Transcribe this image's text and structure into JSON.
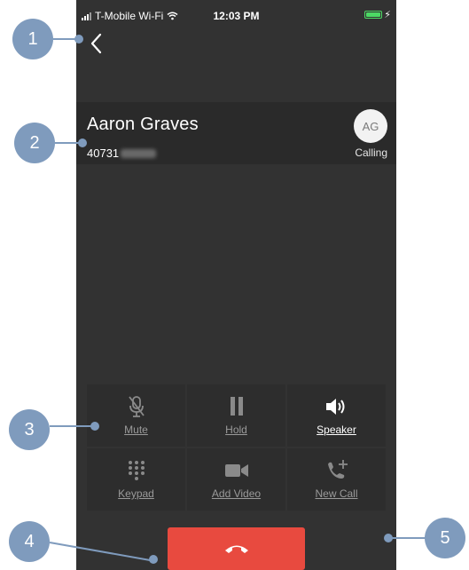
{
  "statusbar": {
    "carrier": "T-Mobile Wi-Fi",
    "time": "12:03 PM"
  },
  "contact": {
    "name": "Aaron Graves",
    "number_visible": "40731",
    "initials": "AG",
    "status": "Calling"
  },
  "controls": [
    {
      "label": "Mute",
      "icon": "microphone-muted-icon",
      "active": false
    },
    {
      "label": "Hold",
      "icon": "pause-icon",
      "active": false
    },
    {
      "label": "Speaker",
      "icon": "speaker-icon",
      "active": true
    },
    {
      "label": "Keypad",
      "icon": "keypad-icon",
      "active": false
    },
    {
      "label": "Add Video",
      "icon": "video-camera-icon",
      "active": false
    },
    {
      "label": "New Call",
      "icon": "phone-plus-icon",
      "active": false
    }
  ],
  "end_call": {
    "icon": "hang-up-icon"
  },
  "callouts": [
    "1",
    "2",
    "3",
    "4",
    "5"
  ],
  "colors": {
    "background": "#323232",
    "end_call": "#e84a3f",
    "callout": "#7f9bbd",
    "battery": "#4cd964"
  }
}
